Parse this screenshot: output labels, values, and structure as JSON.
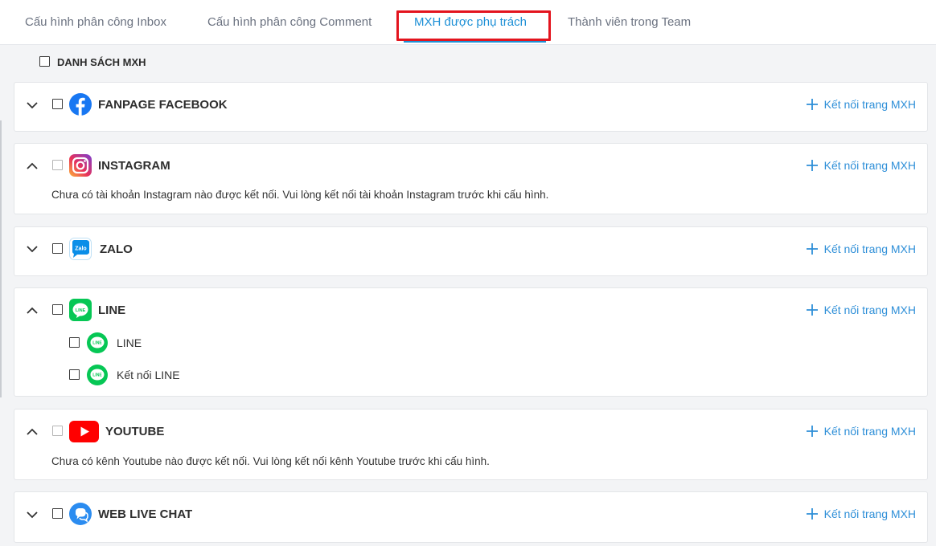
{
  "tabs": [
    {
      "label": "Cấu hình phân công Inbox"
    },
    {
      "label": "Cấu hình phân công Comment"
    },
    {
      "label": "MXH được phụ trách",
      "active": true
    },
    {
      "label": "Thành viên trong Team"
    }
  ],
  "list_header": {
    "label": "DANH SÁCH MXH"
  },
  "connect_label": "Kết nối trang MXH",
  "colors": {
    "accent": "#1e90d6",
    "highlight": "#e3141e",
    "facebook": "#1877f2",
    "line": "#06c755",
    "youtube": "#ff0000",
    "zalo": "#0068ff",
    "webchat": "#2b8cf0"
  },
  "platforms": {
    "facebook": {
      "title": "FANPAGE FACEBOOK",
      "icon": "facebook-icon",
      "expanded": false
    },
    "instagram": {
      "title": "INSTAGRAM",
      "icon": "instagram-icon",
      "expanded": true,
      "message": "Chưa có tài khoản Instagram nào được kết nối. Vui lòng kết nối tài khoản Instagram trước khi cấu hình."
    },
    "zalo": {
      "title": "ZALO",
      "icon": "zalo-icon",
      "expanded": false
    },
    "line": {
      "title": "LINE",
      "icon": "line-icon",
      "expanded": true,
      "accounts": [
        {
          "label": "LINE"
        },
        {
          "label": "Kết nối LINE"
        }
      ]
    },
    "youtube": {
      "title": "YOUTUBE",
      "icon": "youtube-icon",
      "expanded": true,
      "message": "Chưa có kênh Youtube nào được kết nối. Vui lòng kết nối kênh Youtube trước khi cấu hình."
    },
    "webchat": {
      "title": "WEB LIVE CHAT",
      "icon": "chat-bubble-icon",
      "expanded": false
    }
  }
}
